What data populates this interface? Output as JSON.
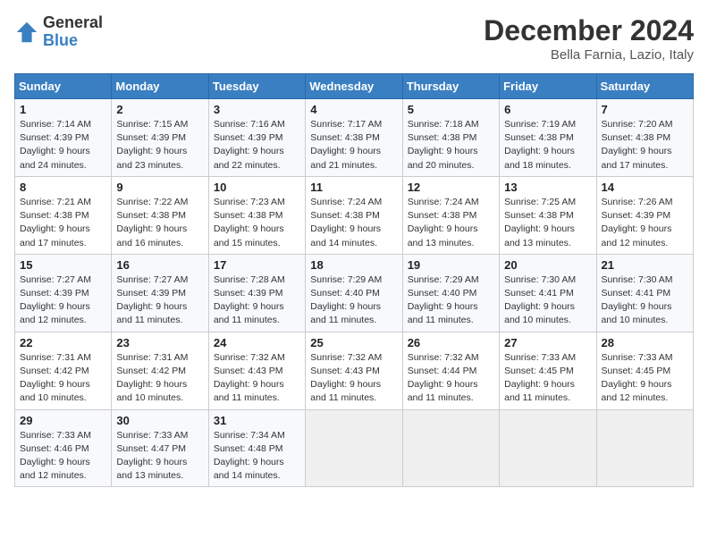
{
  "header": {
    "logo": {
      "line1": "General",
      "line2": "Blue"
    },
    "title": "December 2024",
    "location": "Bella Farnia, Lazio, Italy"
  },
  "weekdays": [
    "Sunday",
    "Monday",
    "Tuesday",
    "Wednesday",
    "Thursday",
    "Friday",
    "Saturday"
  ],
  "weeks": [
    [
      {
        "day": "1",
        "sunrise": "7:14 AM",
        "sunset": "4:39 PM",
        "daylight": "9 hours and 24 minutes."
      },
      {
        "day": "2",
        "sunrise": "7:15 AM",
        "sunset": "4:39 PM",
        "daylight": "9 hours and 23 minutes."
      },
      {
        "day": "3",
        "sunrise": "7:16 AM",
        "sunset": "4:39 PM",
        "daylight": "9 hours and 22 minutes."
      },
      {
        "day": "4",
        "sunrise": "7:17 AM",
        "sunset": "4:38 PM",
        "daylight": "9 hours and 21 minutes."
      },
      {
        "day": "5",
        "sunrise": "7:18 AM",
        "sunset": "4:38 PM",
        "daylight": "9 hours and 20 minutes."
      },
      {
        "day": "6",
        "sunrise": "7:19 AM",
        "sunset": "4:38 PM",
        "daylight": "9 hours and 18 minutes."
      },
      {
        "day": "7",
        "sunrise": "7:20 AM",
        "sunset": "4:38 PM",
        "daylight": "9 hours and 17 minutes."
      }
    ],
    [
      {
        "day": "8",
        "sunrise": "7:21 AM",
        "sunset": "4:38 PM",
        "daylight": "9 hours and 17 minutes."
      },
      {
        "day": "9",
        "sunrise": "7:22 AM",
        "sunset": "4:38 PM",
        "daylight": "9 hours and 16 minutes."
      },
      {
        "day": "10",
        "sunrise": "7:23 AM",
        "sunset": "4:38 PM",
        "daylight": "9 hours and 15 minutes."
      },
      {
        "day": "11",
        "sunrise": "7:24 AM",
        "sunset": "4:38 PM",
        "daylight": "9 hours and 14 minutes."
      },
      {
        "day": "12",
        "sunrise": "7:24 AM",
        "sunset": "4:38 PM",
        "daylight": "9 hours and 13 minutes."
      },
      {
        "day": "13",
        "sunrise": "7:25 AM",
        "sunset": "4:38 PM",
        "daylight": "9 hours and 13 minutes."
      },
      {
        "day": "14",
        "sunrise": "7:26 AM",
        "sunset": "4:39 PM",
        "daylight": "9 hours and 12 minutes."
      }
    ],
    [
      {
        "day": "15",
        "sunrise": "7:27 AM",
        "sunset": "4:39 PM",
        "daylight": "9 hours and 12 minutes."
      },
      {
        "day": "16",
        "sunrise": "7:27 AM",
        "sunset": "4:39 PM",
        "daylight": "9 hours and 11 minutes."
      },
      {
        "day": "17",
        "sunrise": "7:28 AM",
        "sunset": "4:39 PM",
        "daylight": "9 hours and 11 minutes."
      },
      {
        "day": "18",
        "sunrise": "7:29 AM",
        "sunset": "4:40 PM",
        "daylight": "9 hours and 11 minutes."
      },
      {
        "day": "19",
        "sunrise": "7:29 AM",
        "sunset": "4:40 PM",
        "daylight": "9 hours and 11 minutes."
      },
      {
        "day": "20",
        "sunrise": "7:30 AM",
        "sunset": "4:41 PM",
        "daylight": "9 hours and 10 minutes."
      },
      {
        "day": "21",
        "sunrise": "7:30 AM",
        "sunset": "4:41 PM",
        "daylight": "9 hours and 10 minutes."
      }
    ],
    [
      {
        "day": "22",
        "sunrise": "7:31 AM",
        "sunset": "4:42 PM",
        "daylight": "9 hours and 10 minutes."
      },
      {
        "day": "23",
        "sunrise": "7:31 AM",
        "sunset": "4:42 PM",
        "daylight": "9 hours and 10 minutes."
      },
      {
        "day": "24",
        "sunrise": "7:32 AM",
        "sunset": "4:43 PM",
        "daylight": "9 hours and 11 minutes."
      },
      {
        "day": "25",
        "sunrise": "7:32 AM",
        "sunset": "4:43 PM",
        "daylight": "9 hours and 11 minutes."
      },
      {
        "day": "26",
        "sunrise": "7:32 AM",
        "sunset": "4:44 PM",
        "daylight": "9 hours and 11 minutes."
      },
      {
        "day": "27",
        "sunrise": "7:33 AM",
        "sunset": "4:45 PM",
        "daylight": "9 hours and 11 minutes."
      },
      {
        "day": "28",
        "sunrise": "7:33 AM",
        "sunset": "4:45 PM",
        "daylight": "9 hours and 12 minutes."
      }
    ],
    [
      {
        "day": "29",
        "sunrise": "7:33 AM",
        "sunset": "4:46 PM",
        "daylight": "9 hours and 12 minutes."
      },
      {
        "day": "30",
        "sunrise": "7:33 AM",
        "sunset": "4:47 PM",
        "daylight": "9 hours and 13 minutes."
      },
      {
        "day": "31",
        "sunrise": "7:34 AM",
        "sunset": "4:48 PM",
        "daylight": "9 hours and 14 minutes."
      },
      null,
      null,
      null,
      null
    ]
  ],
  "labels": {
    "sunrise": "Sunrise:",
    "sunset": "Sunset:",
    "daylight": "Daylight:"
  }
}
